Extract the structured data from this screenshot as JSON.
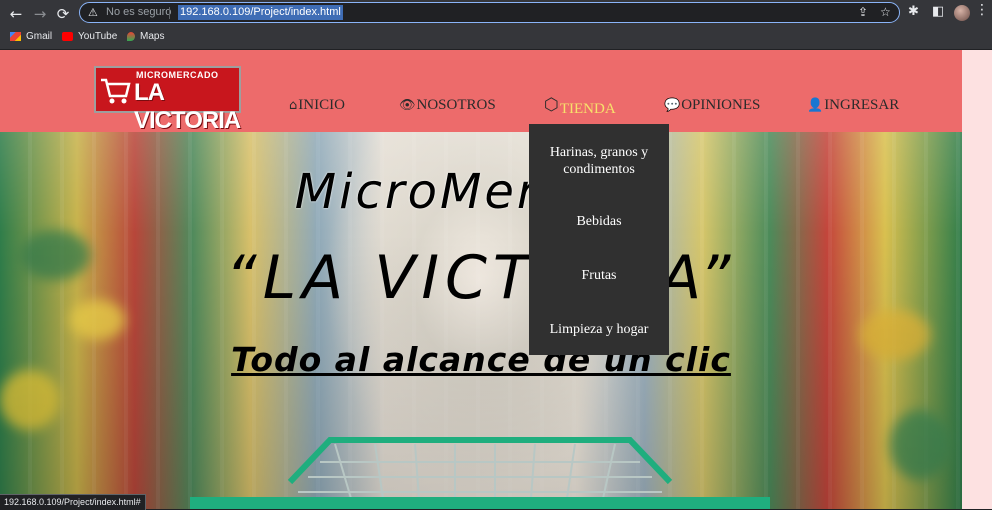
{
  "browser": {
    "back": "←",
    "forward": "→",
    "reload": "⟳",
    "warning_icon": "⚠",
    "security_label": "No es seguro",
    "url": "192.168.0.109/Project/index.html",
    "share_icon": "⇪",
    "star_icon": "☆",
    "extensions_icon": "✱",
    "sidebar_icon": "◧",
    "menu_icon": "⋮"
  },
  "bookmarks": [
    {
      "label": "Gmail",
      "color": "#ea4335"
    },
    {
      "label": "YouTube",
      "color": "#ff0000"
    },
    {
      "label": "Maps",
      "color": "#34a853"
    }
  ],
  "site": {
    "logo": {
      "top": "MICROMERCADO",
      "main": "LA VICTORIA"
    },
    "menu": [
      {
        "icon": "⌂",
        "label": "INICIO"
      },
      {
        "icon": "👁",
        "label": "NOSOTROS"
      },
      {
        "icon": "⬡",
        "label": "TIENDA"
      },
      {
        "icon": "💬",
        "label": "OPINIONES"
      },
      {
        "icon": "👤",
        "label": "INGRESAR"
      }
    ],
    "hero": {
      "line1": "MicroMercado",
      "line2": "“LA VICTORIA”",
      "line3": "Todo al alcance de un clic"
    },
    "dropdown": [
      "Harinas, granos y condimentos",
      "Bebidas",
      "Frutas",
      "Limpieza y hogar"
    ]
  },
  "status_bar": "192.168.0.109/Project/index.html#"
}
